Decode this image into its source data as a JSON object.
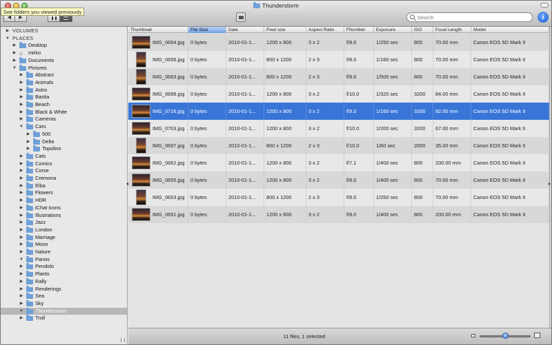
{
  "window": {
    "title": "Thunderstorm",
    "tooltip": "See folders you viewed previously",
    "nav_back": "◀",
    "nav_forward": "▶"
  },
  "search": {
    "placeholder": "Search"
  },
  "info_label": "i",
  "sidebar": {
    "rows": [
      {
        "label": "VOLUMES",
        "level": 0,
        "expanded": false,
        "header": true
      },
      {
        "label": "PLACES",
        "level": 0,
        "expanded": true,
        "header": true
      },
      {
        "label": "Desktop",
        "level": 1,
        "expanded": false
      },
      {
        "label": "mirko",
        "level": 1,
        "expanded": false,
        "icon": "home"
      },
      {
        "label": "Documents",
        "level": 1,
        "expanded": false
      },
      {
        "label": "Pictures",
        "level": 1,
        "expanded": true
      },
      {
        "label": "Abstract",
        "level": 2,
        "expanded": false
      },
      {
        "label": "Animals",
        "level": 2,
        "expanded": false
      },
      {
        "label": "Astro",
        "level": 2,
        "expanded": false
      },
      {
        "label": "Bastia",
        "level": 2,
        "expanded": false
      },
      {
        "label": "Beach",
        "level": 2,
        "expanded": false
      },
      {
        "label": "Black & White",
        "level": 2,
        "expanded": false
      },
      {
        "label": "Cameras",
        "level": 2,
        "expanded": false
      },
      {
        "label": "Cars",
        "level": 2,
        "expanded": true
      },
      {
        "label": "500",
        "level": 3,
        "expanded": false
      },
      {
        "label": "Delta",
        "level": 3,
        "expanded": false
      },
      {
        "label": "Topolino",
        "level": 3,
        "expanded": false
      },
      {
        "label": "Cats",
        "level": 2,
        "expanded": false
      },
      {
        "label": "Comics",
        "level": 2,
        "expanded": false
      },
      {
        "label": "Corse",
        "level": 2,
        "expanded": false
      },
      {
        "label": "Cremona",
        "level": 2,
        "expanded": false
      },
      {
        "label": "Elba",
        "level": 2,
        "expanded": false
      },
      {
        "label": "Flowers",
        "level": 2,
        "expanded": false
      },
      {
        "label": "HDR",
        "level": 2,
        "expanded": false
      },
      {
        "label": "iChat Icons",
        "level": 2,
        "expanded": false
      },
      {
        "label": "Illustrations",
        "level": 2,
        "expanded": false
      },
      {
        "label": "Jazz",
        "level": 2,
        "expanded": false
      },
      {
        "label": "London",
        "level": 2,
        "expanded": false
      },
      {
        "label": "Marriage",
        "level": 2,
        "expanded": false
      },
      {
        "label": "Moon",
        "level": 2,
        "expanded": false
      },
      {
        "label": "Nature",
        "level": 2,
        "expanded": false
      },
      {
        "label": "Panos",
        "level": 2,
        "expanded": true
      },
      {
        "label": "Pendolo",
        "level": 2,
        "expanded": false
      },
      {
        "label": "Plants",
        "level": 2,
        "expanded": false
      },
      {
        "label": "Rally",
        "level": 2,
        "expanded": false
      },
      {
        "label": "Renderings",
        "level": 2,
        "expanded": false
      },
      {
        "label": "Sea",
        "level": 2,
        "expanded": false
      },
      {
        "label": "Sky",
        "level": 2,
        "expanded": false
      },
      {
        "label": "Thunderstorm",
        "level": 2,
        "expanded": true,
        "selected": true
      },
      {
        "label": "Troll",
        "level": 2,
        "expanded": false
      }
    ]
  },
  "table": {
    "columns": [
      "Thumbnail",
      "File Size",
      "Date",
      "Pixel size",
      "Aspect Ratio",
      "FNumber",
      "Exposure",
      "ISO",
      "Focal Length",
      "Model"
    ],
    "sorted_column": 1,
    "rows": [
      {
        "name": "IMG_0654.jpg",
        "size": "0 bytes",
        "date": "2010-01-1...",
        "pixels": "1200 x 800",
        "ratio": "3 x 2",
        "fnumber": "f/8.0",
        "exposure": "1/250 sec",
        "iso": "800",
        "focal": "70.00 mm",
        "model": "Canon EOS 5D Mark II",
        "orient": "land"
      },
      {
        "name": "IMG_0656.jpg",
        "size": "0 bytes",
        "date": "2010-01-1...",
        "pixels": "800 x 1200",
        "ratio": "2 x 3",
        "fnumber": "f/8.0",
        "exposure": "1/160 sec",
        "iso": "800",
        "focal": "70.00 mm",
        "model": "Canon EOS 5D Mark II",
        "orient": "port"
      },
      {
        "name": "IMG_0663.jpg",
        "size": "0 bytes",
        "date": "2010-01-1...",
        "pixels": "800 x 1200",
        "ratio": "2 x 3",
        "fnumber": "f/8.0",
        "exposure": "1/500 sec",
        "iso": "800",
        "focal": "70.00 mm",
        "model": "Canon EOS 5D Mark II",
        "orient": "port"
      },
      {
        "name": "IMG_0699.jpg",
        "size": "0 bytes",
        "date": "2010-01-1...",
        "pixels": "1200 x 800",
        "ratio": "3 x 2",
        "fnumber": "f/10.0",
        "exposure": "1/320 sec",
        "iso": "3200",
        "focal": "84.00 mm",
        "model": "Canon EOS 5D Mark II",
        "orient": "land"
      },
      {
        "name": "IMG_0716.jpg",
        "size": "0 bytes",
        "date": "2010-01-1...",
        "pixels": "1200 x 800",
        "ratio": "3 x 2",
        "fnumber": "f/9.0",
        "exposure": "1/160 sec",
        "iso": "3200",
        "focal": "92.00 mm",
        "model": "Canon EOS 5D Mark II",
        "orient": "land",
        "selected": true
      },
      {
        "name": "IMG_0703.jpg",
        "size": "0 bytes",
        "date": "2010-01-1...",
        "pixels": "1200 x 800",
        "ratio": "3 x 2",
        "fnumber": "f/10.0",
        "exposure": "1/200 sec",
        "iso": "3200",
        "focal": "67.00 mm",
        "model": "Canon EOS 5D Mark II",
        "orient": "land"
      },
      {
        "name": "IMG_0697.jpg",
        "size": "0 bytes",
        "date": "2010-01-1...",
        "pixels": "800 x 1200",
        "ratio": "2 x 3",
        "fnumber": "f/10.0",
        "exposure": "1/60 sec",
        "iso": "2000",
        "focal": "35.00 mm",
        "model": "Canon EOS 5D Mark II",
        "orient": "port"
      },
      {
        "name": "IMG_0662.jpg",
        "size": "0 bytes",
        "date": "2010-01-1...",
        "pixels": "1200 x 800",
        "ratio": "3 x 2",
        "fnumber": "f/7.1",
        "exposure": "1/400 sec",
        "iso": "800",
        "focal": "200.00 mm",
        "model": "Canon EOS 5D Mark II",
        "orient": "land"
      },
      {
        "name": "IMG_0655.jpg",
        "size": "0 bytes",
        "date": "2010-01-1...",
        "pixels": "1200 x 800",
        "ratio": "3 x 2",
        "fnumber": "f/8.0",
        "exposure": "1/400 sec",
        "iso": "800",
        "focal": "70.00 mm",
        "model": "Canon EOS 5D Mark II",
        "orient": "land"
      },
      {
        "name": "IMG_0653.jpg",
        "size": "0 bytes",
        "date": "2010-01-1...",
        "pixels": "800 x 1200",
        "ratio": "2 x 3",
        "fnumber": "f/8.0",
        "exposure": "1/250 sec",
        "iso": "800",
        "focal": "70.00 mm",
        "model": "Canon EOS 5D Mark II",
        "orient": "port"
      },
      {
        "name": "IMG_0651.jpg",
        "size": "0 bytes",
        "date": "2010-01-1...",
        "pixels": "1200 x 800",
        "ratio": "3 x 2",
        "fnumber": "f/8.0",
        "exposure": "1/400 sec",
        "iso": "800",
        "focal": "200.00 mm",
        "model": "Canon EOS 5D Mark II",
        "orient": "land"
      }
    ]
  },
  "status": {
    "text": "11 files, 1 selected",
    "zoom_level": 0.5
  },
  "colors": {
    "selection": "#3875d7",
    "sorted_header": "#6f9fe6",
    "folder": "#6fa0d8"
  }
}
